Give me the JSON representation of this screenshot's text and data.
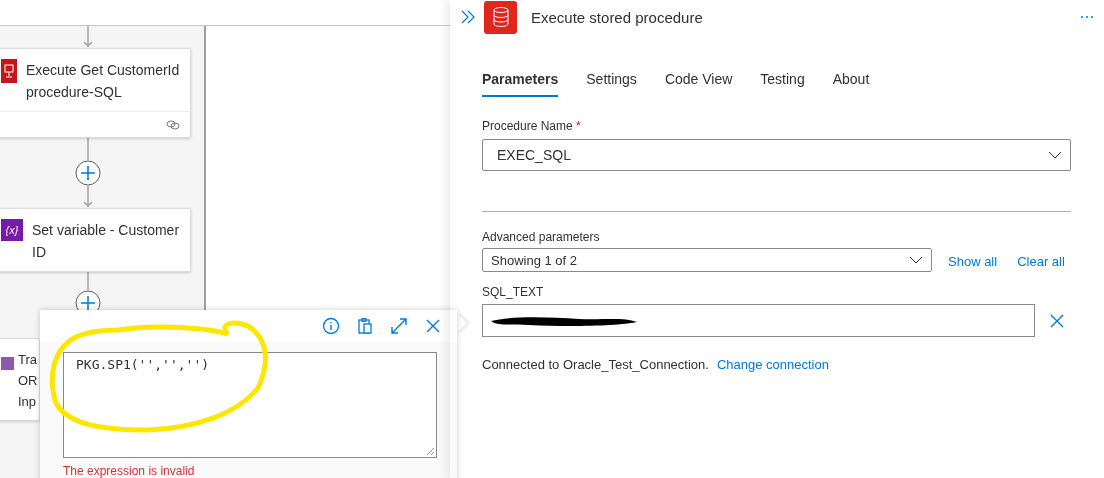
{
  "canvas": {
    "nodes": [
      {
        "kind": "sql",
        "title": "Execute Get CustomerId procedure-SQL",
        "has_footer": true
      },
      {
        "kind": "variable",
        "icon_text": "{x}",
        "title": "Set variable - Customer ID",
        "has_footer": false
      },
      {
        "kind": "transform",
        "lines": [
          "Tra",
          "OR",
          "Inp"
        ],
        "has_footer": false
      }
    ]
  },
  "expression_editor": {
    "value": "PKG.SP1('','','')",
    "error": "The expression is invalid"
  },
  "panel": {
    "title": "Execute stored procedure",
    "tabs": [
      {
        "label": "Parameters",
        "selected": true
      },
      {
        "label": "Settings",
        "selected": false
      },
      {
        "label": "Code View",
        "selected": false
      },
      {
        "label": "Testing",
        "selected": false
      },
      {
        "label": "About",
        "selected": false
      }
    ],
    "procedure_name": {
      "label": "Procedure Name",
      "required_mark": "*",
      "value": "EXEC_SQL"
    },
    "advanced": {
      "label": "Advanced parameters",
      "value": "Showing 1 of 2",
      "links": [
        "Show all",
        "Clear all"
      ]
    },
    "sql_text": {
      "label": "SQL_TEXT",
      "redacted": true
    },
    "connection": {
      "text": "Connected to Oracle_Test_Connection.",
      "link": "Change connection"
    }
  }
}
